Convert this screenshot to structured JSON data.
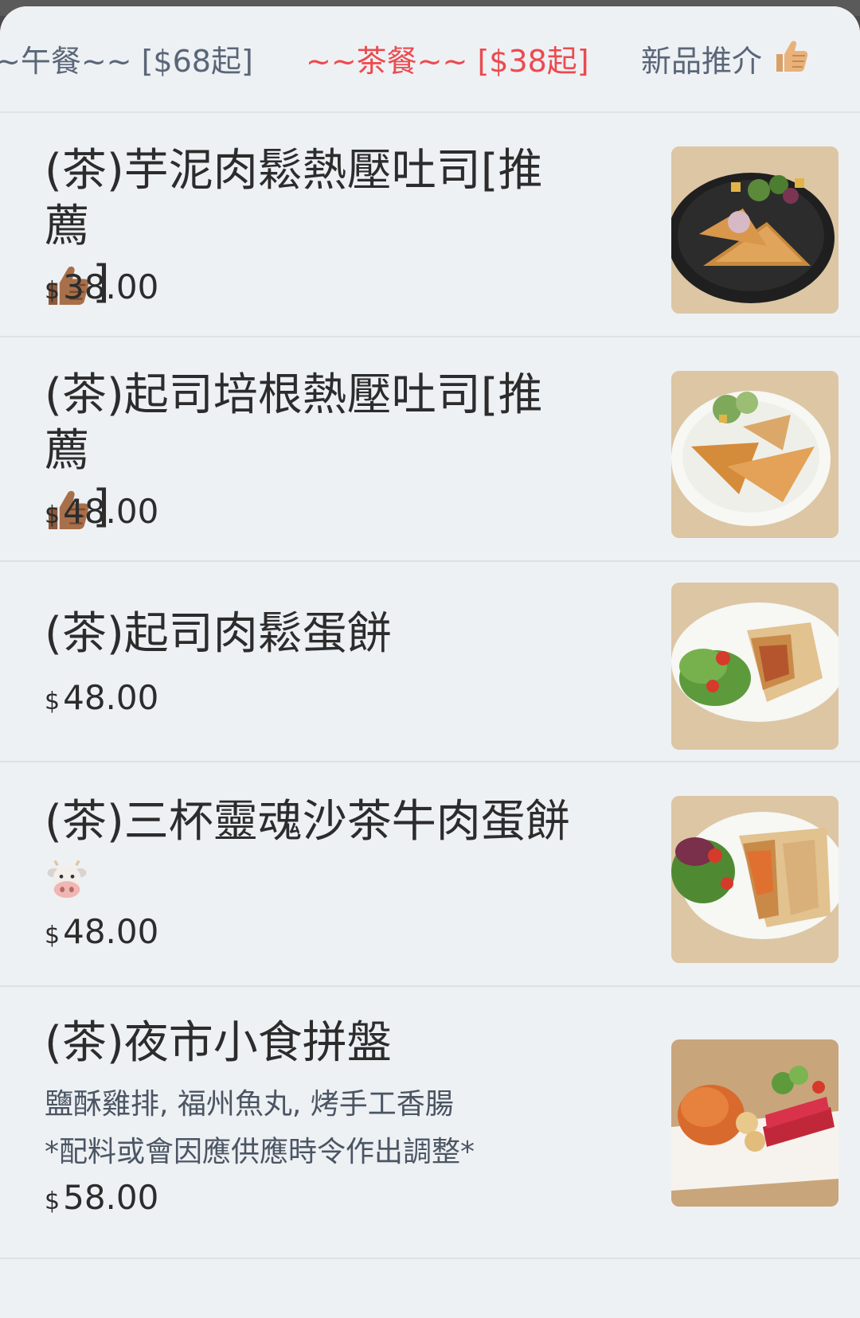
{
  "tabs": {
    "lunch": "~午餐~~ [$68起]",
    "tea": "~~茶餐~~ [$38起]",
    "new": "新品推介"
  },
  "items": [
    {
      "name_line1": "(茶)芋泥肉鬆熱壓吐司[推薦",
      "name_line2_suffix": "]",
      "currency": "$",
      "price": "38.00",
      "photo_icon": "toast-salad-plate-dark"
    },
    {
      "name_line1": "(茶)起司培根熱壓吐司[推薦",
      "name_line2_suffix": "]",
      "currency": "$",
      "price": "48.00",
      "photo_icon": "toast-salad-plate-white"
    },
    {
      "name_line1": "(茶)起司肉鬆蛋餅",
      "currency": "$",
      "price": "48.00",
      "photo_icon": "egg-roll-salad-plate"
    },
    {
      "name_line1": "(茶)三杯靈魂沙茶牛肉蛋餅",
      "currency": "$",
      "price": "48.00",
      "photo_icon": "beef-egg-roll-plate"
    },
    {
      "name_line1": "(茶)夜市小食拼盤",
      "desc_line1": "鹽酥雞排, 福州魚丸, 烤手工香腸",
      "desc_line2": "*配料或會因應供應時令作出調整*",
      "currency": "$",
      "price": "58.00",
      "photo_icon": "snack-platter"
    }
  ],
  "colors": {
    "accent": "#ec4a4f",
    "tab_text": "#5a6678",
    "background": "#eef1f4"
  }
}
